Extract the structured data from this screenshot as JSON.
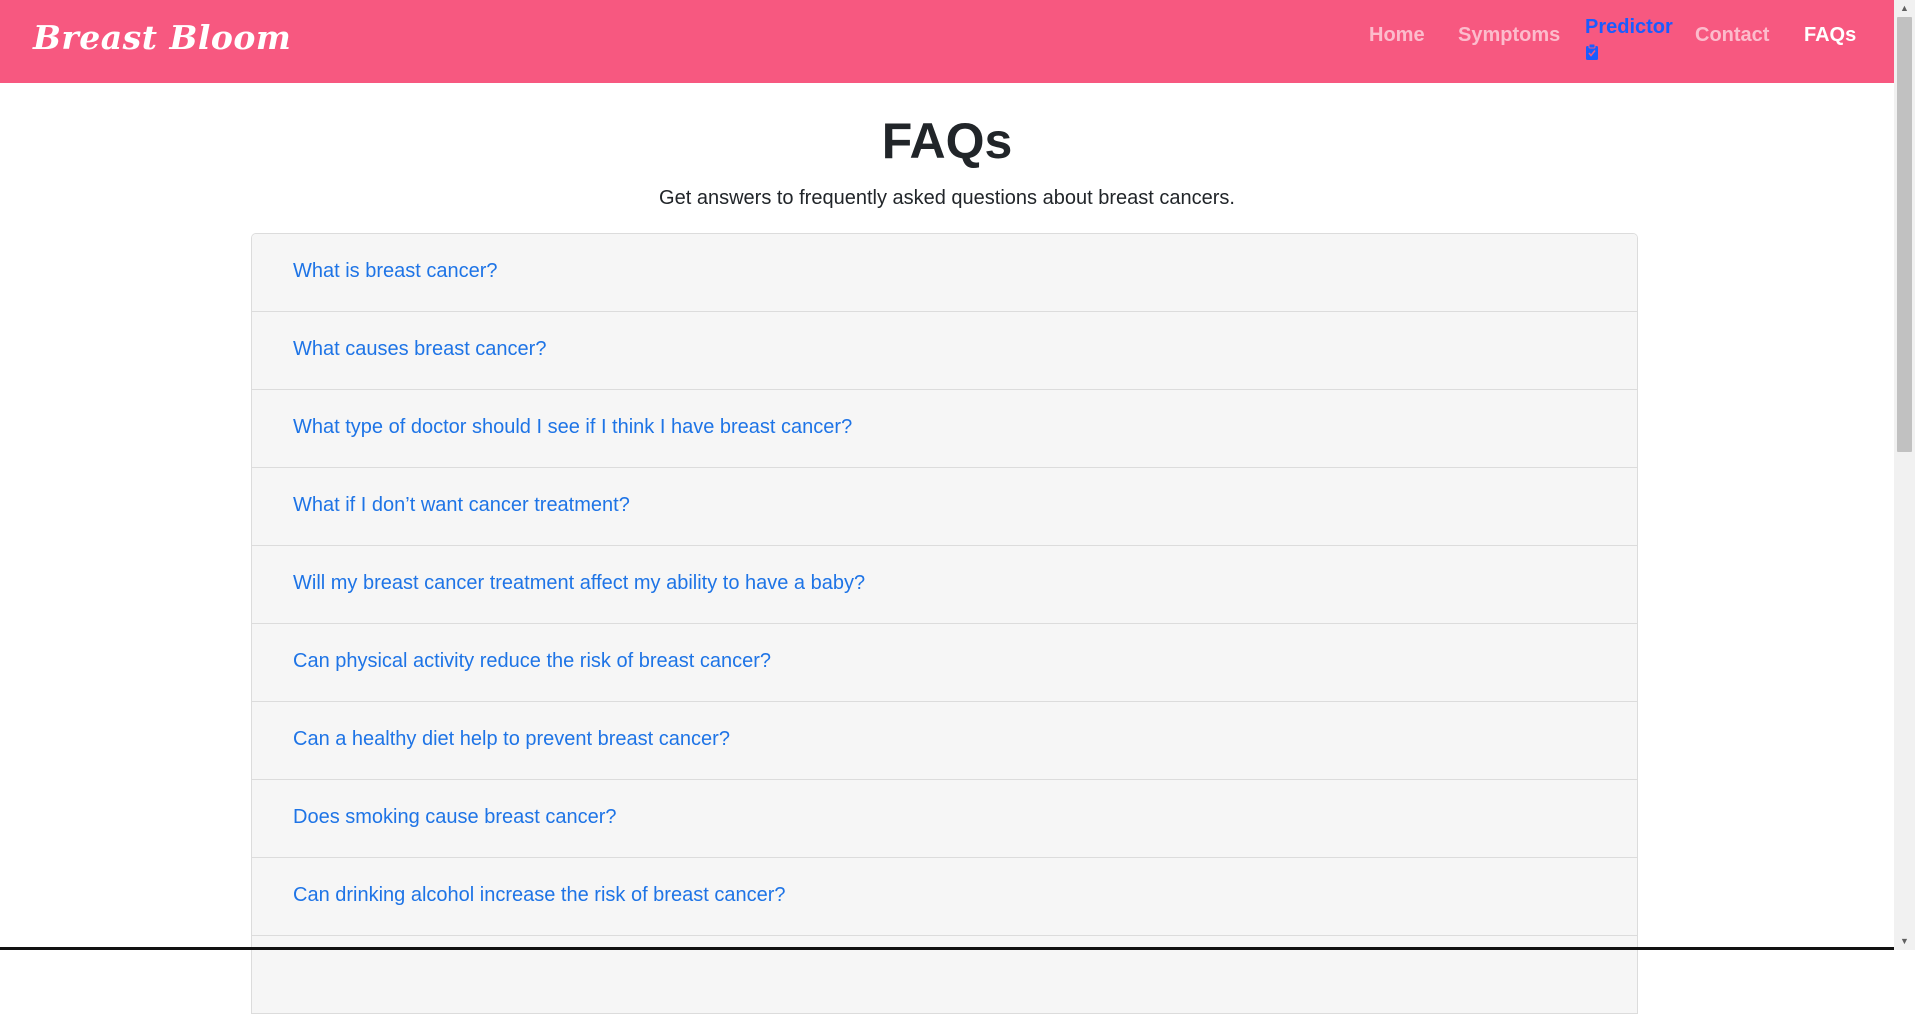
{
  "navbar": {
    "brand": "Breast Bloom",
    "links": [
      {
        "label": "Home"
      },
      {
        "label": "Symptoms"
      },
      {
        "label": "Predictor",
        "icon": "clipboard-icon"
      },
      {
        "label": "Contact"
      },
      {
        "label": "FAQs"
      }
    ],
    "active": "FAQs"
  },
  "page": {
    "title": "FAQs",
    "subtitle": "Get answers to frequently asked questions about breast cancers."
  },
  "faqs": [
    {
      "question": "What is breast cancer?"
    },
    {
      "question": "What causes breast cancer?"
    },
    {
      "question": "What type of doctor should I see if I think I have breast cancer?"
    },
    {
      "question": "What if I don’t want cancer treatment?"
    },
    {
      "question": "Will my breast cancer treatment affect my ability to have a baby?"
    },
    {
      "question": "Can physical activity reduce the risk of breast cancer?"
    },
    {
      "question": "Can a healthy diet help to prevent breast cancer?"
    },
    {
      "question": "Does smoking cause breast cancer?"
    },
    {
      "question": "Can drinking alcohol increase the risk of breast cancer?"
    }
  ],
  "colors": {
    "navbar": "#f75880",
    "link": "#1e74e6",
    "predictor": "#1a5cff"
  }
}
